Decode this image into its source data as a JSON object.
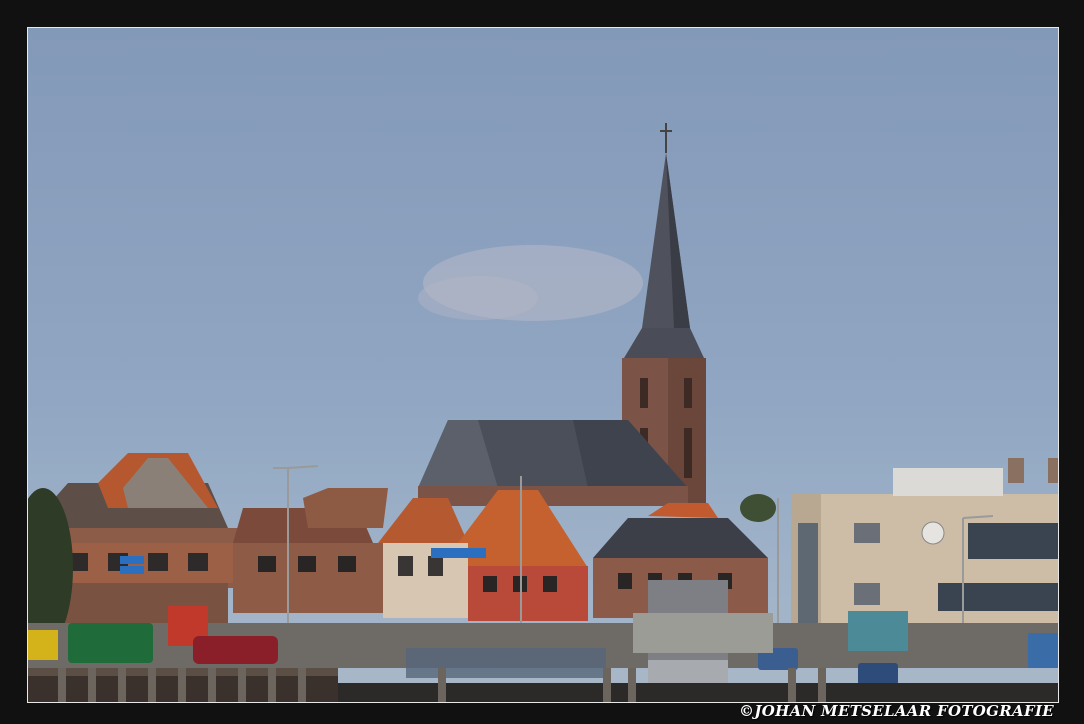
{
  "photo": {
    "subject": "town skyline with church spire and harbour",
    "watermark": "©JOHAN METSELAAR FOTOGRAFIE"
  },
  "colors": {
    "sky_top": "#8399b8",
    "sky_bottom": "#a9b8c8",
    "roof_orange": "#c4582e",
    "slate": "#4a4e58",
    "brick": "#8b5a45",
    "frame": "#111111"
  }
}
